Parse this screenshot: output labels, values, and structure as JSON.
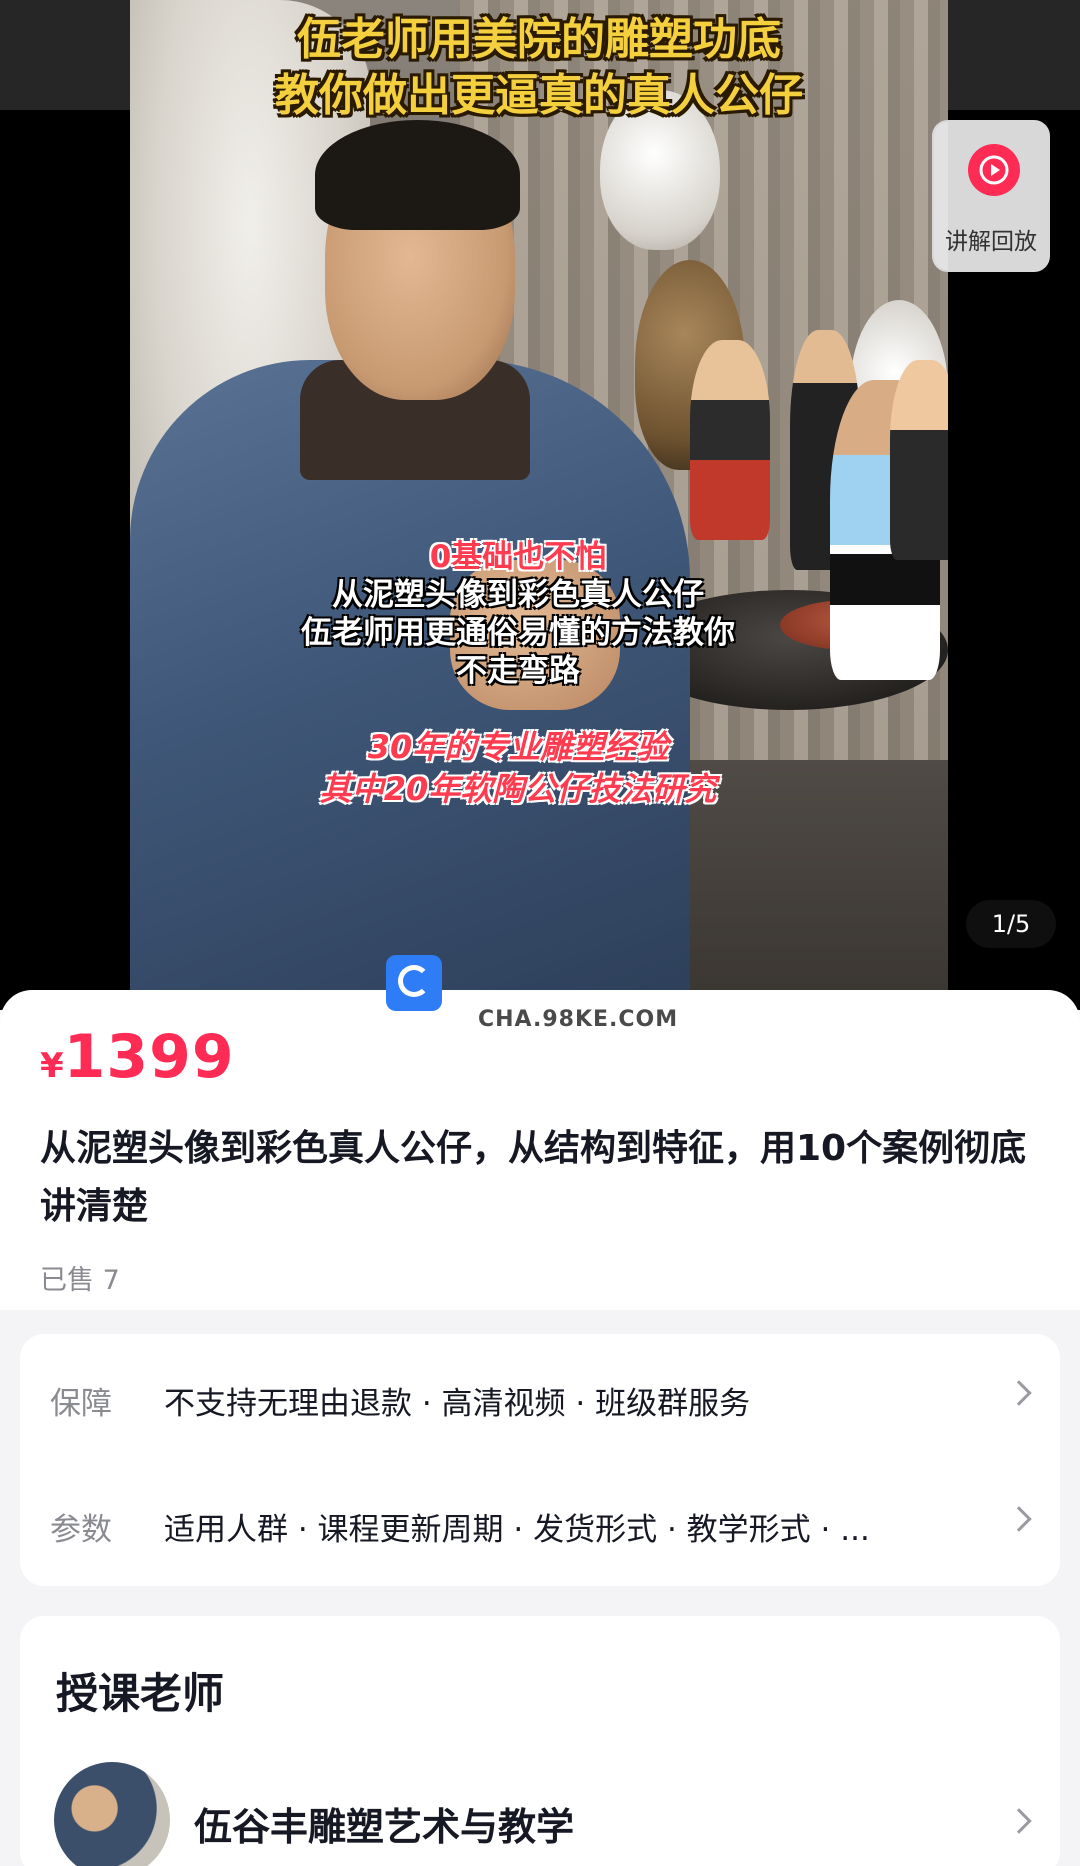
{
  "media": {
    "caption_top": [
      "伍老师用美院的雕塑功底",
      "教你做出更逼真的真人公仔"
    ],
    "caption_mid_highlight": "0基础也不怕",
    "caption_mid": [
      "从泥塑头像到彩色真人公仔",
      "伍老师用更通俗易懂的方法教你",
      "不走弯路"
    ],
    "caption_bottom": [
      "30年的专业雕塑经验",
      "其中20年软陶公仔技法研究"
    ],
    "replay_label": "讲解回放",
    "replay_icon": "play-circle-icon",
    "page_indicator": "1/5"
  },
  "watermark": {
    "text": "CHA.98KE.COM"
  },
  "product": {
    "currency": "¥",
    "price": "1399",
    "title": "从泥塑头像到彩色真人公仔，从结构到特征，用10个案例彻底讲清楚",
    "sold": "已售 7"
  },
  "services": [
    {
      "label": "保障",
      "value": "不支持无理由退款 · 高清视频 · 班级群服务"
    },
    {
      "label": "参数",
      "value": "适用人群 · 课程更新周期 · 发货形式 · 教学形式 · ..."
    }
  ],
  "teacher": {
    "section_title": "授课老师",
    "name": "伍谷丰雕塑艺术与教学"
  },
  "colors": {
    "accent": "#fe2c55",
    "muted": "#8a8b91",
    "text": "#161823"
  }
}
